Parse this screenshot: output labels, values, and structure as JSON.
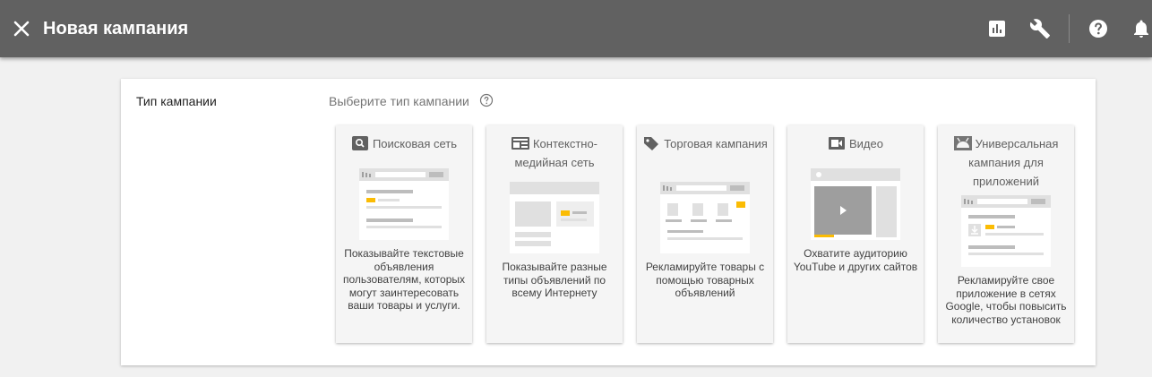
{
  "header": {
    "title": "Новая кампания",
    "icons": [
      "close-icon",
      "bar-chart-icon",
      "wrench-icon",
      "help-icon",
      "bell-icon"
    ]
  },
  "section": {
    "label": "Тип кампании",
    "prompt": "Выберите тип кампании"
  },
  "campaign_types": [
    {
      "icon": "search-icon",
      "title": "Поисковая сеть",
      "description": "Показывайте текстовые объявления пользователям, которых могут заинтересовать ваши товары и услуги."
    },
    {
      "icon": "display-icon",
      "title": "Контекстно-медийная сеть",
      "description": "Показывайте разные типы объявлений по всему Интернету"
    },
    {
      "icon": "tag-icon",
      "title": "Торговая кампания",
      "description": "Рекламируйте товары с помощью товарных объявлений"
    },
    {
      "icon": "video-icon",
      "title": "Видео",
      "description": "Охватите аудиторию YouTube и других сайтов"
    },
    {
      "icon": "android-icon",
      "title": "Универсальная кампания для приложений",
      "description": "Рекламируйте свое приложение в сетях Google, чтобы повысить количество установок"
    }
  ],
  "colors": {
    "topbar": "#616161",
    "accent_yellow": "#fbbc04"
  }
}
